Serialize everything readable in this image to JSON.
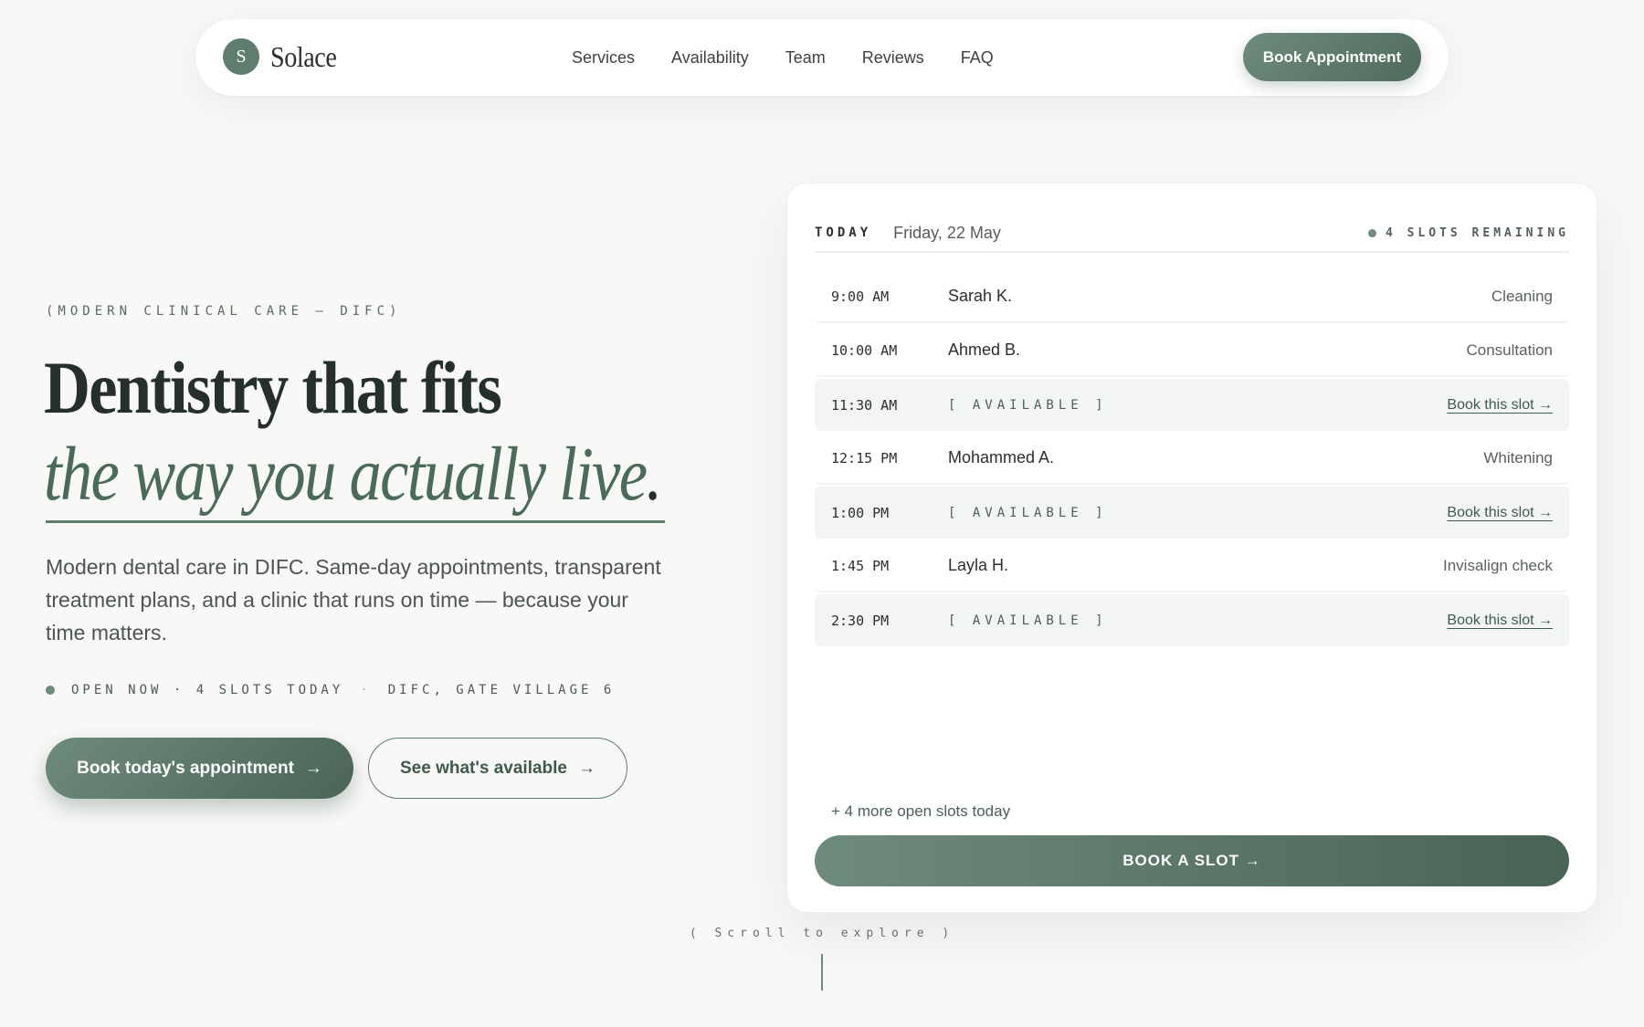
{
  "nav": {
    "logo_letter": "S",
    "brand": "Solace",
    "links": [
      "Services",
      "Availability",
      "Team",
      "Reviews",
      "FAQ"
    ],
    "cta": "Book Appointment"
  },
  "hero": {
    "eyebrow": "(MODERN CLINICAL CARE — DIFC)",
    "title_line1": "Dentistry that fits",
    "title_line2": "the way you actually live",
    "title_period": ".",
    "lead": "Modern dental care in DIFC. Same-day appointments, transparent treatment plans, and a clinic that runs on time — because your time matters.",
    "status_open": "OPEN NOW · 4 SLOTS TODAY",
    "status_separator": "·",
    "status_location": "DIFC, GATE VILLAGE 6",
    "btn_primary": "Book today's appointment",
    "btn_secondary": "See what's available",
    "arrow": "→"
  },
  "schedule": {
    "today_label": "TODAY",
    "date": "Friday, 22 May",
    "slots_remaining": "4 SLOTS REMAINING",
    "rows": [
      {
        "time": "9:00 AM",
        "name": "Sarah K.",
        "service": "Cleaning",
        "available": false
      },
      {
        "time": "10:00 AM",
        "name": "Ahmed B.",
        "service": "Consultation",
        "available": false
      },
      {
        "time": "11:30 AM",
        "name": "[ AVAILABLE ]",
        "service": "Book this slot →",
        "available": true
      },
      {
        "time": "12:15 PM",
        "name": "Mohammed A.",
        "service": "Whitening",
        "available": false
      },
      {
        "time": "1:00 PM",
        "name": "[ AVAILABLE ]",
        "service": "Book this slot →",
        "available": true
      },
      {
        "time": "1:45 PM",
        "name": "Layla H.",
        "service": "Invisalign check",
        "available": false
      },
      {
        "time": "2:30 PM",
        "name": "[ AVAILABLE ]",
        "service": "Book this slot →",
        "available": true
      }
    ],
    "more_slots": "+ 4 more open slots today",
    "book_slot": "BOOK A SLOT →"
  },
  "scroll_hint": "( Scroll to explore )",
  "colors": {
    "accent": "#5f7d6f",
    "accent_dark": "#4a6557",
    "background": "#f8f8f7",
    "text": "#2b2f2d"
  }
}
